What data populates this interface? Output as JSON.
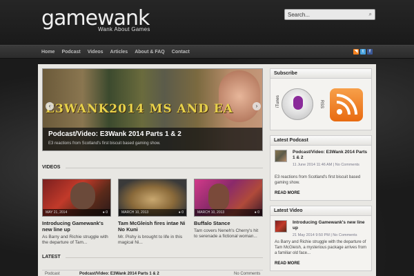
{
  "site": {
    "logo": "gamewank",
    "tagline": "Wank About Games",
    "search_placeholder": "Search..."
  },
  "nav": {
    "items": [
      "Home",
      "Podcast",
      "Videos",
      "Articles",
      "About & FAQ",
      "Contact"
    ],
    "social_icons": [
      "rss-icon",
      "twitter-icon",
      "facebook-icon"
    ]
  },
  "slider": {
    "art_text": "E3WANK2014 MS AND EA",
    "title": "Podcast/Video: E3Wank 2014 Parts 1 & 2",
    "excerpt": "E3 reactions from Scotland's first biscuit based gaming show."
  },
  "videos": {
    "heading": "VIDEOS",
    "items": [
      {
        "date": "MAY 21, 2014",
        "comments": "0",
        "title": "Introducing Gamewank's new line up",
        "excerpt": "As Barry and Richie struggle with the departure of Tam..."
      },
      {
        "date": "MARCH 10, 2013",
        "comments": "0",
        "title": "Tam McGleish fires intae Ni No Kuni",
        "excerpt": "Mr. Pishy is brought to life in this magical Ni..."
      },
      {
        "date": "MARCH 10, 2013",
        "comments": "0",
        "title": "Buffalo Stance",
        "excerpt": "Tam covers Neneh's Cherry's hit to serenade a fictional woman..."
      }
    ]
  },
  "latest": {
    "heading": "LATEST",
    "row_label": "Podcast",
    "row_title": "Podcast/Video: E3Wank 2014 Parts 1 & 2",
    "row_comments": "No Comments"
  },
  "sidebar": {
    "subscribe": {
      "heading": "Subscribe",
      "itunes_label": "iTunes",
      "rss_label": "RSS"
    },
    "latest_podcast": {
      "heading": "Latest Podcast",
      "title": "Podcast/Video: E3Wank 2014 Parts 1 & 2",
      "meta": "11 June 2014 11:46 AM | No Comments",
      "excerpt": "E3 reactions from Scotland's first biscuit based gaming show.",
      "read_more": "READ MORE"
    },
    "latest_video": {
      "heading": "Latest Video",
      "title": "Introducing Gamewank's new line up",
      "meta": "21 May 2014 9:50 PM | No Comments",
      "excerpt": "As Barry and Richie struggle with the departure of Tam McGleish, a mysterious package arrives from a familiar old face...",
      "read_more": "READ MORE"
    }
  },
  "colors": {
    "rss": "#f58220",
    "twitter": "#4aa3df",
    "facebook": "#3b5998",
    "art_text": "#e8d24a"
  }
}
